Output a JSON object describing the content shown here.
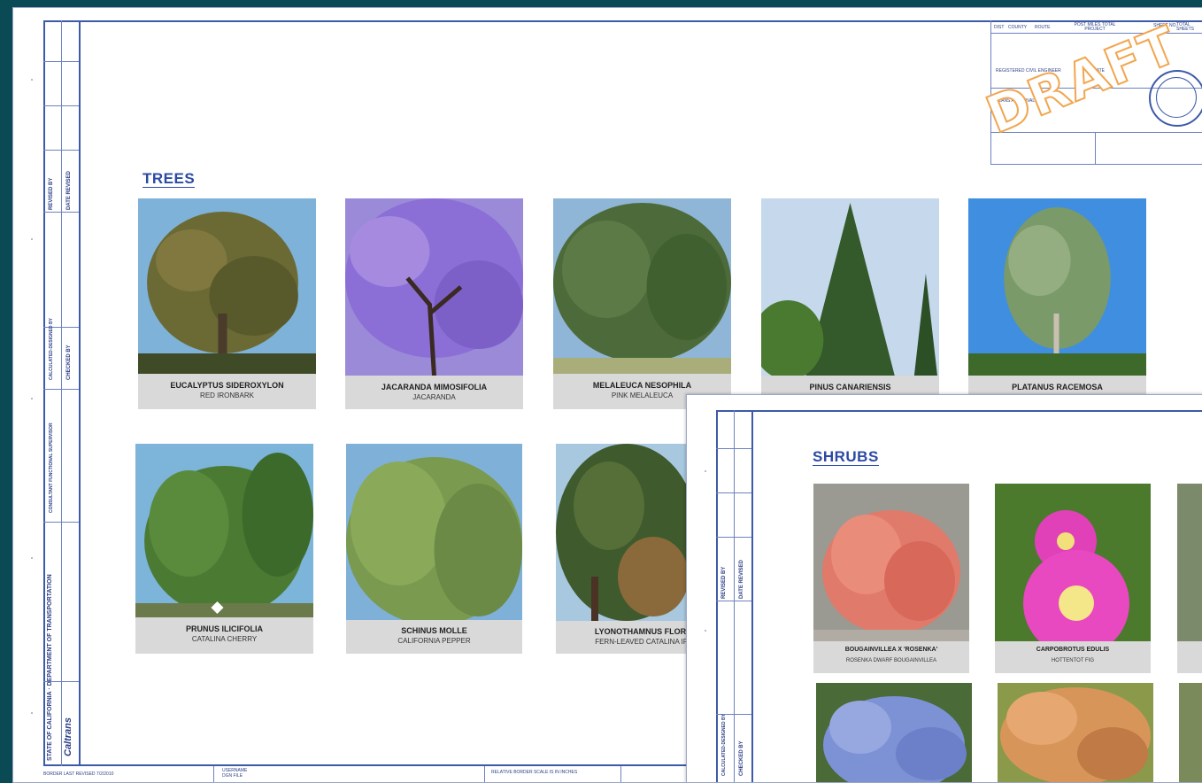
{
  "sheet1": {
    "section_title": "TREES",
    "stamp": "DRAFT",
    "title_block": {
      "headers": [
        "DIST",
        "COUNTY",
        "ROUTE",
        "POST MILES TOTAL PROJECT",
        "SHEET NO.",
        "TOTAL SHEETS"
      ],
      "engineer": "REGISTERED CIVIL ENGINEER",
      "date": "DATE",
      "plans_approval": "PLANS APPROVAL DATE"
    },
    "sidebar": {
      "agency": "STATE OF CALIFORNIA · DEPARTMENT OF TRANSPORTATION",
      "logo": "Caltrans",
      "revised_by": "REVISED BY",
      "date_revised": "DATE REVISED",
      "calculated": "CALCULATED-DESIGNED BY",
      "checked": "CHECKED BY",
      "consultant": "CONSULTANT FUNCTIONAL SUPERVISOR"
    },
    "footer": {
      "border": "BORDER LAST REVISED 7/2/2010",
      "username": "USERNAME",
      "dgn": "DGN FILE",
      "relative": "RELATIVE BORDER SCALE IS IN INCHES"
    },
    "plants": [
      {
        "scientific": "EUCALYPTUS SIDEROXYLON",
        "common": "RED IRONBARK"
      },
      {
        "scientific": "JACARANDA MIMOSIFOLIA",
        "common": "JACARANDA"
      },
      {
        "scientific": "MELALEUCA NESOPHILA",
        "common": "PINK MELALEUCA"
      },
      {
        "scientific": "PINUS CANARIENSIS",
        "common": ""
      },
      {
        "scientific": "PLATANUS RACEMOSA",
        "common": ""
      },
      {
        "scientific": "PRUNUS ILICIFOLIA",
        "common": "CATALINA CHERRY"
      },
      {
        "scientific": "SCHINUS MOLLE",
        "common": "CALIFORNIA PEPPER"
      },
      {
        "scientific": "LYONOTHAMNUS FLORIB",
        "common": "FERN-LEAVED CATALINA IRO"
      }
    ]
  },
  "sheet2": {
    "section_title": "SHRUBS",
    "sidebar": {
      "revised_by": "REVISED BY",
      "date_revised": "DATE REVISED",
      "calculated": "CALCULATED-DESIGNED BY",
      "checked": "CHECKED BY"
    },
    "plants": [
      {
        "scientific": "BOUGAINVILLEA X 'ROSENKA'",
        "common": "ROSENKA DWARF BOUGAINVILLEA"
      },
      {
        "scientific": "CARPOBROTUS EDULIS",
        "common": "HOTTENTOT FIG"
      }
    ]
  }
}
